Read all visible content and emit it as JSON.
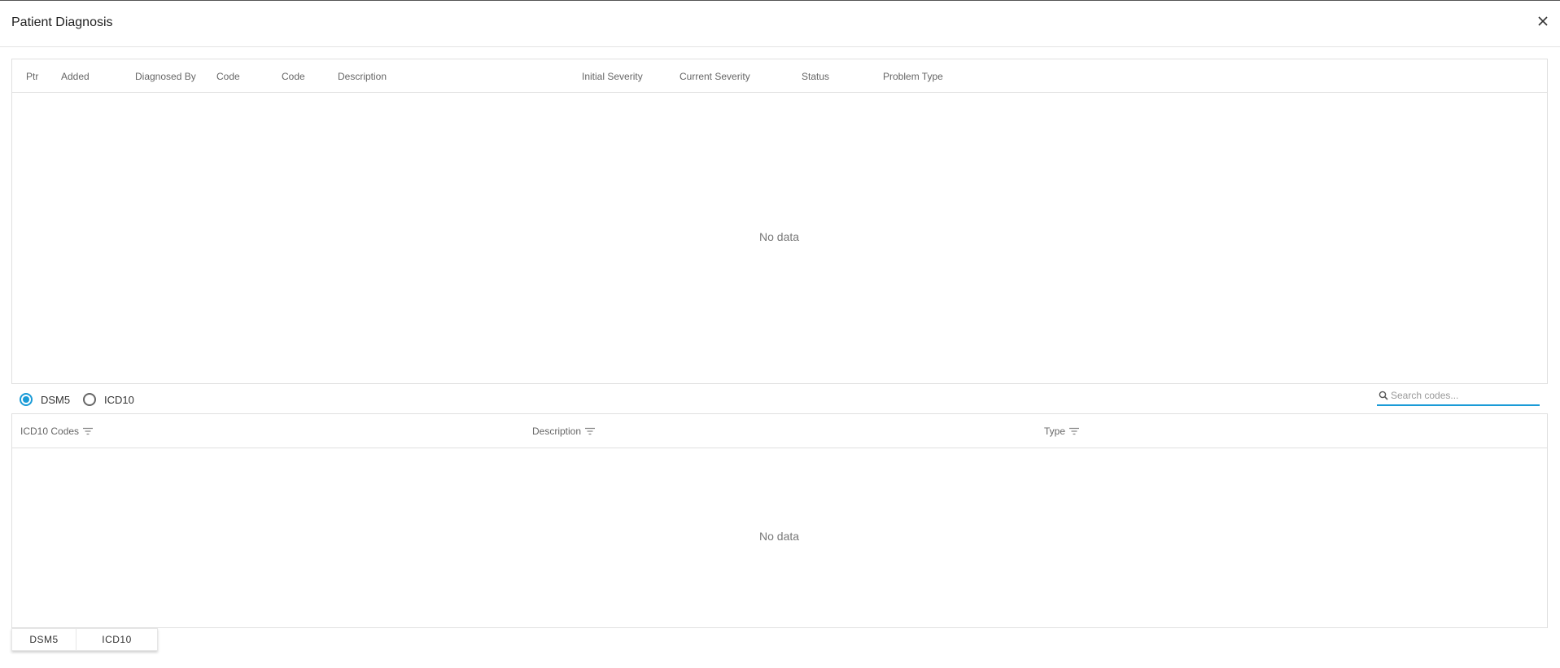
{
  "dialog": {
    "title": "Patient Diagnosis",
    "close_icon": "close-icon"
  },
  "diagnosis_table": {
    "columns": [
      "Ptr",
      "Added",
      "Diagnosed By",
      "Code",
      "Code",
      "Description",
      "Initial Severity",
      "Current Severity",
      "Status",
      "Problem Type"
    ],
    "rows": [],
    "empty_text": "No data"
  },
  "code_system": {
    "options": [
      "DSM5",
      "ICD10"
    ],
    "selected": "DSM5",
    "accent": "#1a9bd7"
  },
  "search": {
    "placeholder": "Search codes...",
    "value": "",
    "icon": "search-icon"
  },
  "codes_table": {
    "columns": [
      "ICD10 Codes",
      "Description",
      "Type"
    ],
    "column_icon": "filter-icon",
    "rows": [],
    "empty_text": "No data"
  },
  "bottom_tabs": [
    "DSM5",
    "ICD10"
  ]
}
